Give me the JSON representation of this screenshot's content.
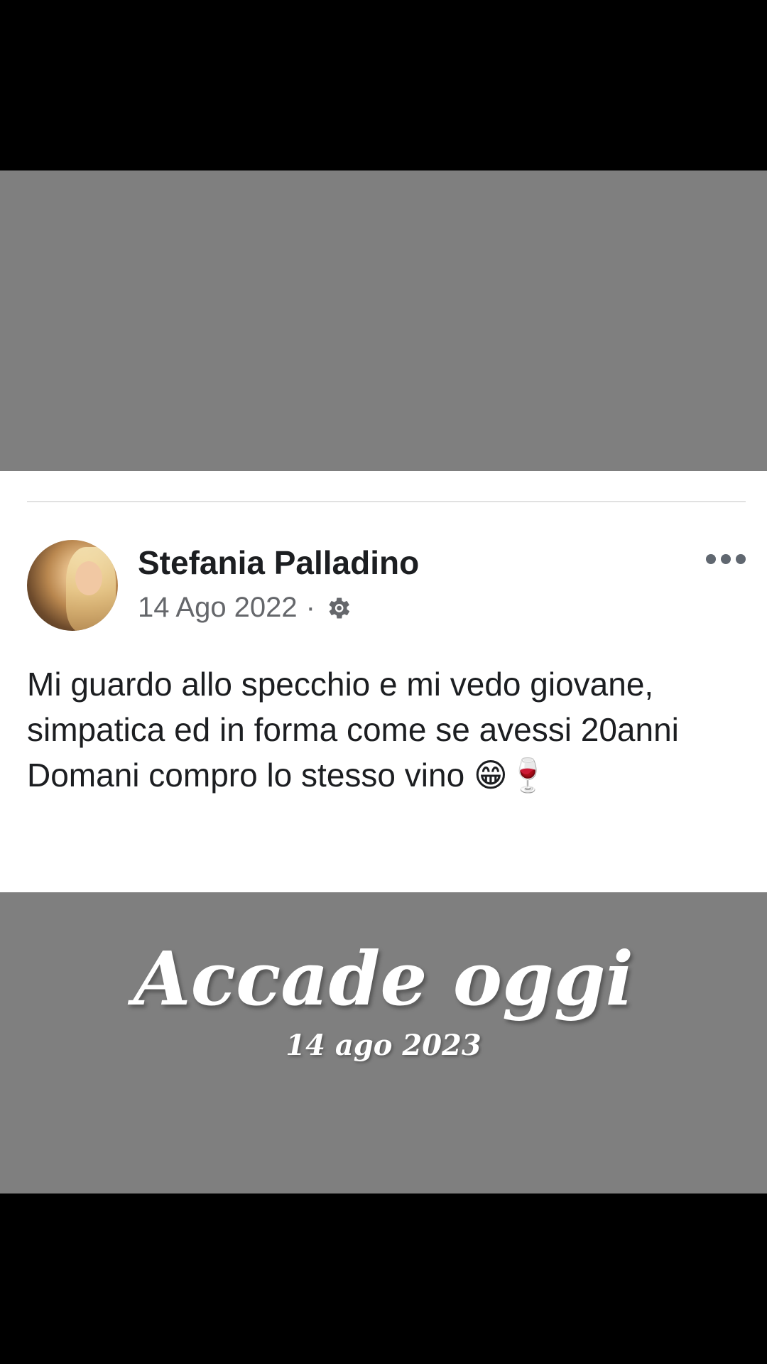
{
  "post": {
    "author_name": "Stefania Palladino",
    "date": "14 Ago 2022",
    "separator": "·",
    "privacy_icon": "gear-icon",
    "more_icon": "more-options-icon",
    "text": "Mi guardo allo specchio e mi vedo giovane, simpatica ed in forma come se avessi 20anni\nDomani compro lo stesso vino 😁🍷"
  },
  "memory": {
    "title": "Accade oggi",
    "date": "14 ago 2023"
  },
  "colors": {
    "gray_band": "#7f7f7f",
    "card_bg": "#ffffff",
    "name_text": "#1c1e21",
    "meta_text": "#65676b"
  }
}
